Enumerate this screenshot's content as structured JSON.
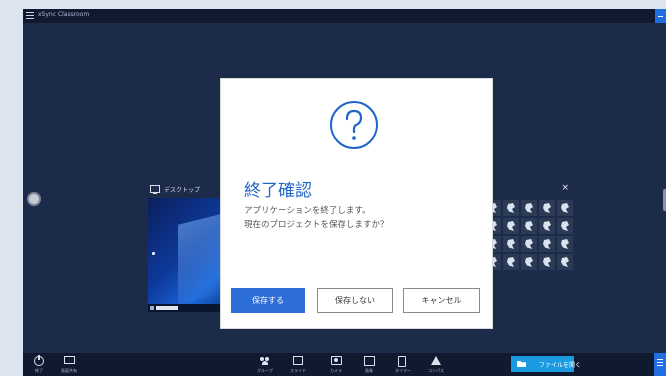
{
  "app": {
    "title": "xSync Classroom"
  },
  "desktop_panel": {
    "label": "デスクトップ"
  },
  "dialog": {
    "title": "終了確認",
    "message_line1": "アプリケーションを終了します。",
    "message_line2": "現在のプロジェクトを保存しますか？",
    "save_label": "保存する",
    "no_save_label": "保存しない",
    "cancel_label": "キャンセル"
  },
  "toolbar": {
    "items": [
      {
        "label": "終了",
        "icon": "power-icon"
      },
      {
        "label": "画面共有",
        "icon": "cast-icon"
      },
      {
        "label": "グループ",
        "icon": "people-icon"
      },
      {
        "label": "スライド",
        "icon": "slide-icon"
      },
      {
        "label": "カメラ",
        "icon": "camera-icon"
      },
      {
        "label": "画像",
        "icon": "image-icon"
      },
      {
        "label": "タイマー",
        "icon": "timer-icon"
      },
      {
        "label": "コンパス",
        "icon": "compass-icon"
      }
    ],
    "open_file_label": "ファイルを開く"
  },
  "colors": {
    "accent": "#2d6ed8",
    "background": "#1c2b4a",
    "toolbar": "#0f1a30",
    "dialog_title": "#2066c9"
  }
}
